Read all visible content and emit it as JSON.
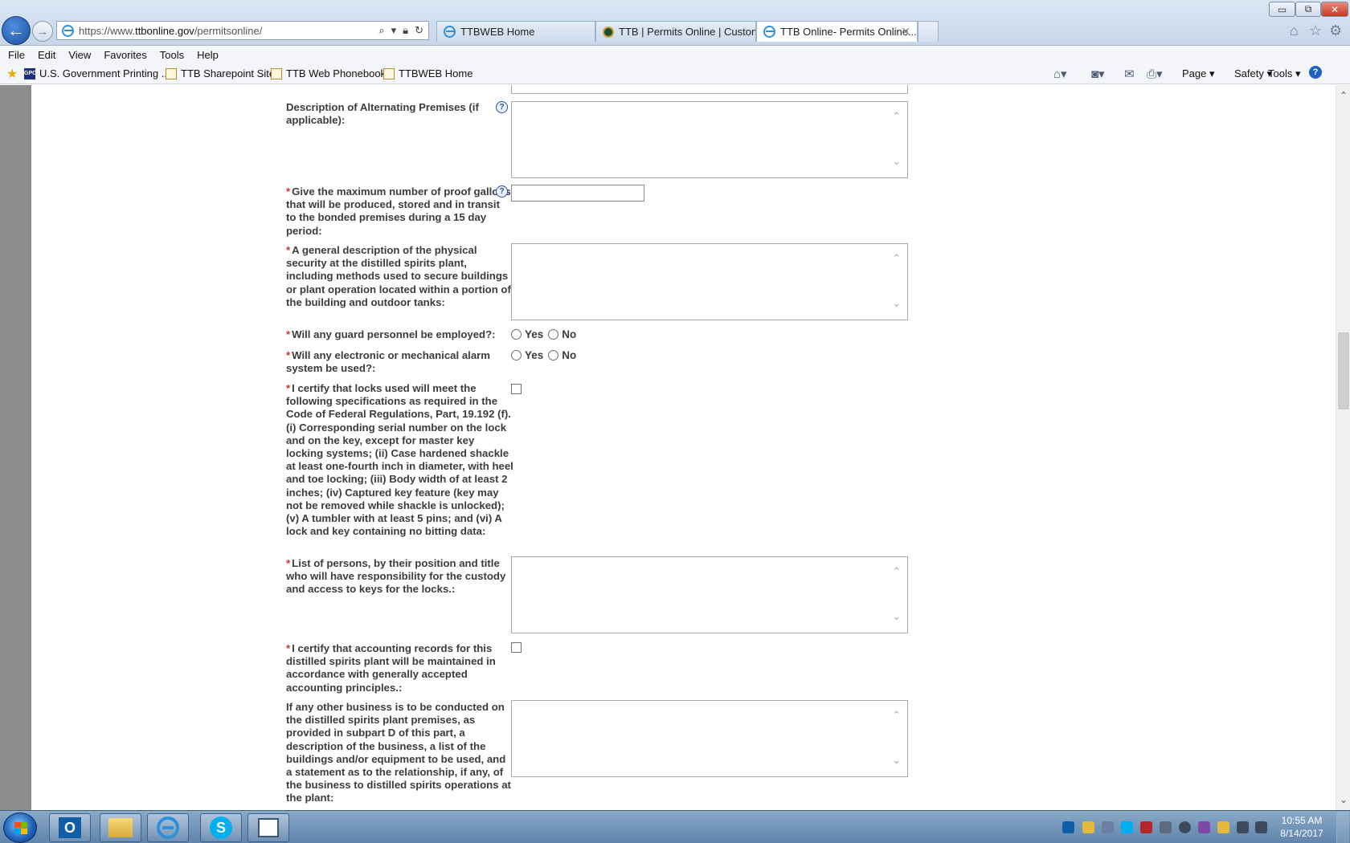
{
  "browser": {
    "url_prefix": "https://www.",
    "url_domain": "ttbonline.gov",
    "url_path": "/permitsonline/",
    "tabs": [
      {
        "title": "TTBWEB Home"
      },
      {
        "title": "TTB | Permits Online | Custom..."
      },
      {
        "title": "TTB Online- Permits Online..."
      }
    ],
    "window_controls": {
      "minimize": "▭",
      "maximize": "⧉",
      "close": "✕"
    }
  },
  "menu": [
    "File",
    "Edit",
    "View",
    "Favorites",
    "Tools",
    "Help"
  ],
  "favorites": [
    {
      "label": "U.S. Government Printing ...",
      "icon": "gpo-icon",
      "icon_text": "GPO"
    },
    {
      "label": "TTB Sharepoint Site",
      "icon": "page-icon"
    },
    {
      "label": "TTB Web Phonebook",
      "icon": "page-icon"
    },
    {
      "label": "TTBWEB Home",
      "icon": "page-icon"
    }
  ],
  "command_bar": {
    "page": "Page",
    "safety": "Safety",
    "tools": "Tools",
    "help": "?"
  },
  "form": {
    "alternating_premises_label": "Description of Alternating Premises (if applicable):",
    "proof_gallons_label": "Give the maximum number of proof gallons that will be produced, stored and in transit to the bonded premises during a 15 day period:",
    "physical_security_label": "A general description of the physical security at the distilled spirits plant, including methods used to secure buildings or plant operation located within a portion of the building and outdoor tanks:",
    "guard_personnel_label": "Will any guard personnel be employed?:",
    "alarm_system_label": "Will any electronic or mechanical alarm system be used?:",
    "locks_certify_label": "I certify that locks used will meet the following specifications as required in the Code of Federal Regulations, Part, 19.192 (f). (i) Corresponding serial number on the lock and on the key, except for master key locking systems; (ii) Case hardened shackle at least one-fourth inch in diameter, with heel and toe locking; (iii) Body width of at least 2 inches; (iv) Captured key feature (key may not be removed while shackle is unlocked); (v) A tumbler with at least 5 pins; and (vi) A lock and key containing no bitting data:",
    "key_custody_label": "List of persons, by their position and title who will have responsibility for the custody and access to keys for the locks.:",
    "accounting_certify_label": "I certify that accounting records for this distilled spirits plant will be maintained in accordance with generally accepted accounting principles.:",
    "other_business_label": "If any other business is to be conducted on the distilled spirits plant premises, as provided in subpart D of this part, a description of the business, a list of the buildings and/or equipment to be used, and a statement as to the relationship, if any, of the business to distilled spirits operations at the plant:",
    "required_marker": "*",
    "help_marker": "?",
    "yes": "Yes",
    "no": "No",
    "proof_gallons_value": ""
  },
  "taskbar": {
    "time": "10:55 AM",
    "date": "8/14/2017",
    "apps": [
      {
        "icon": "outlook-icon",
        "glyph": "O"
      },
      {
        "icon": "file-explorer-icon"
      },
      {
        "icon": "internet-explorer-icon"
      },
      {
        "icon": "skype-icon",
        "glyph": "S"
      },
      {
        "icon": "application-icon"
      }
    ]
  },
  "colors": {
    "required": "#c0392b",
    "help": "#1b4fb4",
    "label": "#3c3c3c",
    "taskbar": "#6b8fb6"
  }
}
